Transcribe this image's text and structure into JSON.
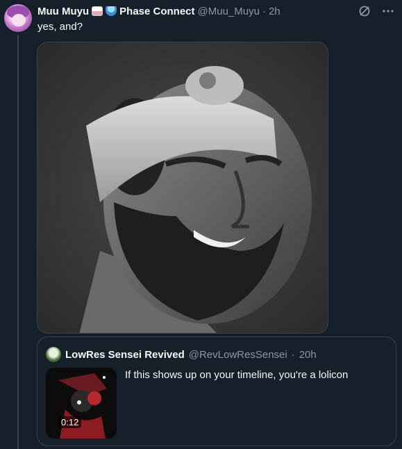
{
  "tweet": {
    "display_name": "Muu Muyu",
    "affiliation": "Phase Connect",
    "handle": "@Muu_Muyu",
    "separator": "·",
    "time": "2h",
    "text": "yes, and?"
  },
  "quote": {
    "display_name": "LowRes Sensei Revived",
    "handle": "@RevLowResSensei",
    "separator": "·",
    "time": "20h",
    "text": "If this shows up on your timeline, you're a lolicon",
    "video_duration": "0:12"
  },
  "icons": {
    "grok_icon": "grok-slash-circle-icon",
    "more_icon": "more-horizontal-icon"
  },
  "colors": {
    "background": "#15202b",
    "text_primary": "#f7f9f9",
    "text_secondary": "#8b98a5",
    "border": "#38444d"
  }
}
